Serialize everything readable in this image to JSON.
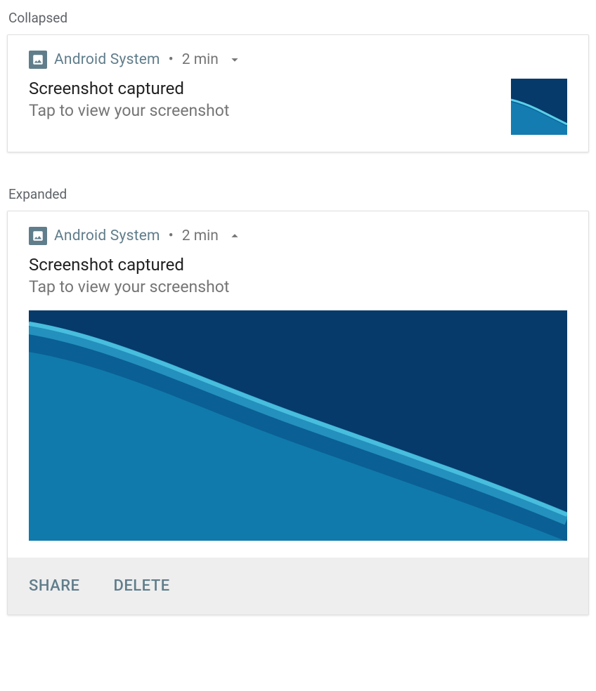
{
  "collapsed": {
    "section_label": "Collapsed",
    "app_name": "Android  System",
    "separator": "•",
    "timestamp": "2 min",
    "title": "Screenshot captured",
    "body": "Tap to view your screenshot"
  },
  "expanded": {
    "section_label": "Expanded",
    "app_name": "Android  System",
    "separator": "•",
    "timestamp": "2 min",
    "title": "Screenshot captured",
    "body": "Tap to view your screenshot",
    "actions": {
      "share": "SHARE",
      "delete": "DELETE"
    }
  },
  "colors": {
    "accent": "#607d8b",
    "image_dark": "#063a6b",
    "image_mid": "#0a5f99",
    "image_light": "#2baed4"
  }
}
